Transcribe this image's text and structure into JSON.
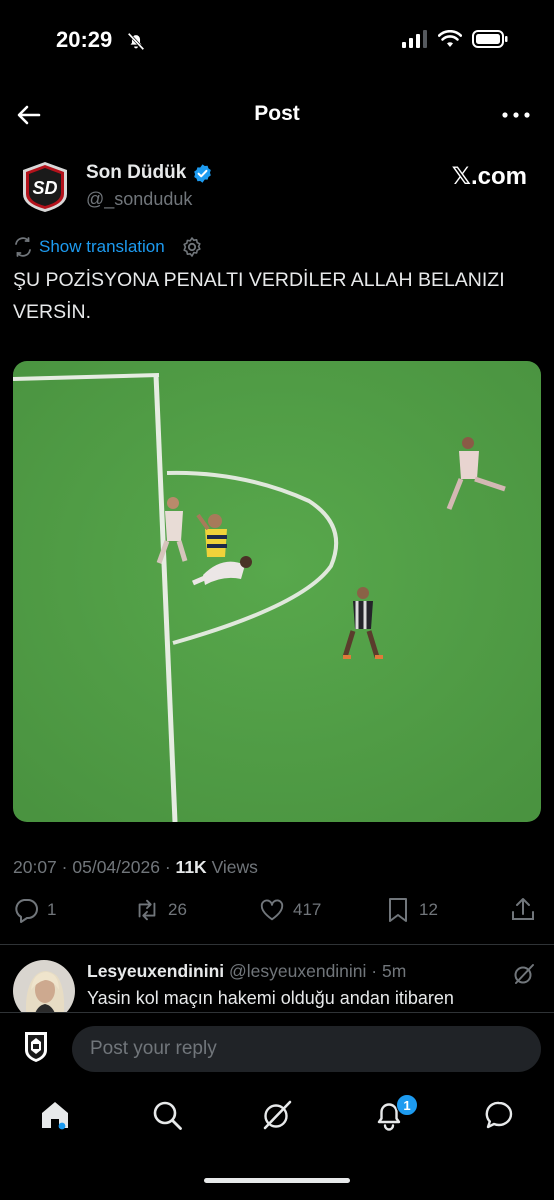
{
  "status_bar": {
    "time": "20:29"
  },
  "header": {
    "title": "Post"
  },
  "author": {
    "name": "Son Düdük",
    "handle": "@_sonduduk",
    "logo_text": "SD",
    "source_badge": "𝕏.com"
  },
  "post": {
    "translate_label": "Show translation",
    "text": "ŞU POZİSYONA PENALTI VERDİLER ALLAH BELANIZI VERSİN."
  },
  "meta": {
    "time": "20:07",
    "date": "05/04/2026",
    "views_count": "11K",
    "views_label": "Views"
  },
  "actions": {
    "replies": "1",
    "reposts": "26",
    "likes": "417",
    "bookmarks": "12"
  },
  "reply": {
    "name": "Lesyeuxendinini",
    "handle": "@lesyeuxendinini",
    "age": "5m",
    "text": "Yasin kol maçın hakemi olduğu andan itibaren"
  },
  "compose": {
    "placeholder": "Post your reply"
  },
  "tabbar": {
    "notifications_badge": "1"
  },
  "colors": {
    "accent": "#1d9bf0",
    "background": "#000000",
    "pitch": "#4f9f45",
    "muted": "#71767b"
  }
}
